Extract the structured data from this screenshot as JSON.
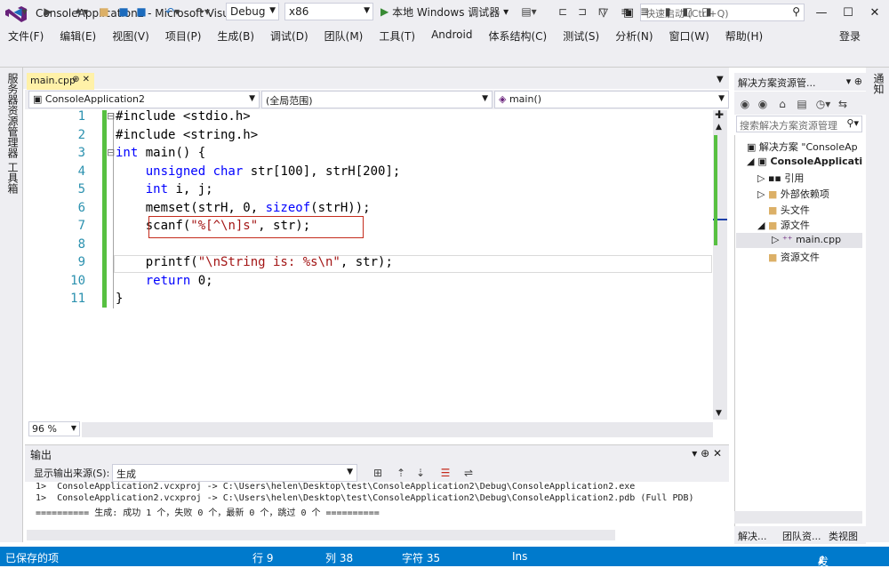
{
  "window": {
    "title": "ConsoleApplication2 - Microsoft Visual Studio",
    "quick_launch_placeholder": "快速启动 (Ctrl+Q)"
  },
  "menu": [
    "文件(F)",
    "编辑(E)",
    "视图(V)",
    "项目(P)",
    "生成(B)",
    "调试(D)",
    "团队(M)",
    "工具(T)",
    "Android",
    "体系结构(C)",
    "测试(S)",
    "分析(N)",
    "窗口(W)",
    "帮助(H)"
  ],
  "login": "登录",
  "toolbar": {
    "config": "Debug",
    "platform": "x86",
    "run_label": "本地 Windows 调试器"
  },
  "left_tabs": [
    "服务器资源管理器",
    "工具箱"
  ],
  "doc_tab": {
    "name": "main.cpp"
  },
  "navbar": {
    "project": "ConsoleApplication2",
    "scope": "(全局范围)",
    "member": "main()"
  },
  "code": {
    "line_numbers": [
      "1",
      "2",
      "3",
      "4",
      "5",
      "6",
      "7",
      "8",
      "9",
      "10",
      "11"
    ],
    "lines": [
      [
        {
          "t": "#include <stdio.h>",
          "c": ""
        }
      ],
      [
        {
          "t": "#include <string.h>",
          "c": ""
        }
      ],
      [
        {
          "t": "int",
          "c": "kw"
        },
        {
          "t": " main() {",
          "c": ""
        }
      ],
      [
        {
          "t": "    ",
          "c": ""
        },
        {
          "t": "unsigned char",
          "c": "kw"
        },
        {
          "t": " str[100], strH[200];",
          "c": ""
        }
      ],
      [
        {
          "t": "    ",
          "c": ""
        },
        {
          "t": "int",
          "c": "kw"
        },
        {
          "t": " i, j;",
          "c": ""
        }
      ],
      [
        {
          "t": "    memset(strH, 0, ",
          "c": ""
        },
        {
          "t": "sizeof",
          "c": "kw"
        },
        {
          "t": "(strH));",
          "c": ""
        }
      ],
      [
        {
          "t": "    scanf(",
          "c": ""
        },
        {
          "t": "\"%[^\\n]s\"",
          "c": "str"
        },
        {
          "t": ", str);",
          "c": ""
        }
      ],
      [],
      [
        {
          "t": "    printf(",
          "c": ""
        },
        {
          "t": "\"\\nString is: %s\\n\"",
          "c": "str"
        },
        {
          "t": ", str);",
          "c": ""
        }
      ],
      [
        {
          "t": "    ",
          "c": ""
        },
        {
          "t": "return",
          "c": "kw"
        },
        {
          "t": " 0;",
          "c": ""
        }
      ],
      [
        {
          "t": "}",
          "c": ""
        }
      ]
    ]
  },
  "zoom": "96 %",
  "output": {
    "title": "输出",
    "source_label": "显示输出来源(S):",
    "source_value": "生成",
    "lines": [
      "1>  ConsoleApplication2.vcxproj -> C:\\Users\\helen\\Desktop\\test\\ConsoleApplication2\\Debug\\ConsoleApplication2.exe",
      "1>  ConsoleApplication2.vcxproj -> C:\\Users\\helen\\Desktop\\test\\ConsoleApplication2\\Debug\\ConsoleApplication2.pdb (Full PDB)",
      "========== 生成: 成功 1 个，失败 0 个，最新 0 个，跳过 0 个 =========="
    ]
  },
  "solution": {
    "title": "解决方案资源管...",
    "search_placeholder": "搜索解决方案资源管理",
    "tree": [
      "解决方案 \"ConsoleAp",
      "ConsoleApplicati",
      "引用",
      "外部依赖项",
      "头文件",
      "源文件",
      "main.cpp",
      "资源文件"
    ],
    "bottom_tabs": [
      "解决...",
      "团队资...",
      "类视图"
    ]
  },
  "right_tab": "通知",
  "status": {
    "ready": "已保存的项",
    "row": "行 9",
    "col": "列 38",
    "char": "字符 35",
    "mode": "Ins",
    "publish": "发布"
  }
}
